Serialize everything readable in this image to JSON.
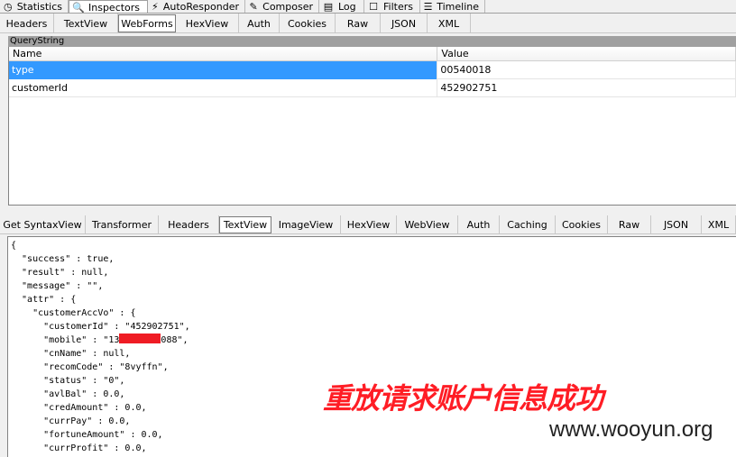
{
  "top_tabs": [
    {
      "label": "Statistics",
      "icon": "clock-icon",
      "glyph": "◷"
    },
    {
      "label": "Inspectors",
      "icon": "magnifier-icon",
      "glyph": "🔍"
    },
    {
      "label": "AutoResponder",
      "icon": "lightning-icon",
      "glyph": "⚡"
    },
    {
      "label": "Composer",
      "icon": "pencil-icon",
      "glyph": "✎"
    },
    {
      "label": "Log",
      "icon": "log-icon",
      "glyph": "▤"
    },
    {
      "label": "Filters",
      "icon": "checkbox-icon",
      "glyph": "☐"
    },
    {
      "label": "Timeline",
      "icon": "timeline-icon",
      "glyph": "☰"
    }
  ],
  "request_tabs": [
    "Headers",
    "TextView",
    "WebForms",
    "HexView",
    "Auth",
    "Cookies",
    "Raw",
    "JSON",
    "XML"
  ],
  "querystring": {
    "title": "QueryString",
    "columns": {
      "name": "Name",
      "value": "Value"
    },
    "rows": [
      {
        "name": "type",
        "value": "00540018"
      },
      {
        "name": "customerId",
        "value": "452902751"
      }
    ]
  },
  "response_tabs": [
    "Get SyntaxView",
    "Transformer",
    "Headers",
    "TextView",
    "ImageView",
    "HexView",
    "WebView",
    "Auth",
    "Caching",
    "Cookies",
    "Raw",
    "JSON",
    "XML"
  ],
  "response_body": {
    "lines": [
      "{",
      "  \"success\" : true,",
      "  \"result\" : null,",
      "  \"message\" : \"\",",
      "  \"attr\" : {",
      "    \"customerAccVo\" : {",
      "      \"customerId\" : \"452902751\",",
      "      \"mobile\" : \"13",
      "      \"cnName\" : null,",
      "      \"recomCode\" : \"8vyffn\",",
      "      \"status\" : \"0\",",
      "      \"avlBal\" : 0.0,",
      "      \"credAmount\" : 0.0,",
      "      \"currPay\" : 0.0,",
      "      \"fortuneAmount\" : 0.0,",
      "      \"currProfit\" : 0.0,"
    ],
    "mobile_suffix": "088\","
  },
  "overlay_text": "重放请求账户信息成功",
  "watermark": "www.wooyun.org",
  "colors": {
    "selected_row": "#3399ff",
    "overlay_red": "#ff1d25",
    "redaction": "#ef1c24"
  }
}
